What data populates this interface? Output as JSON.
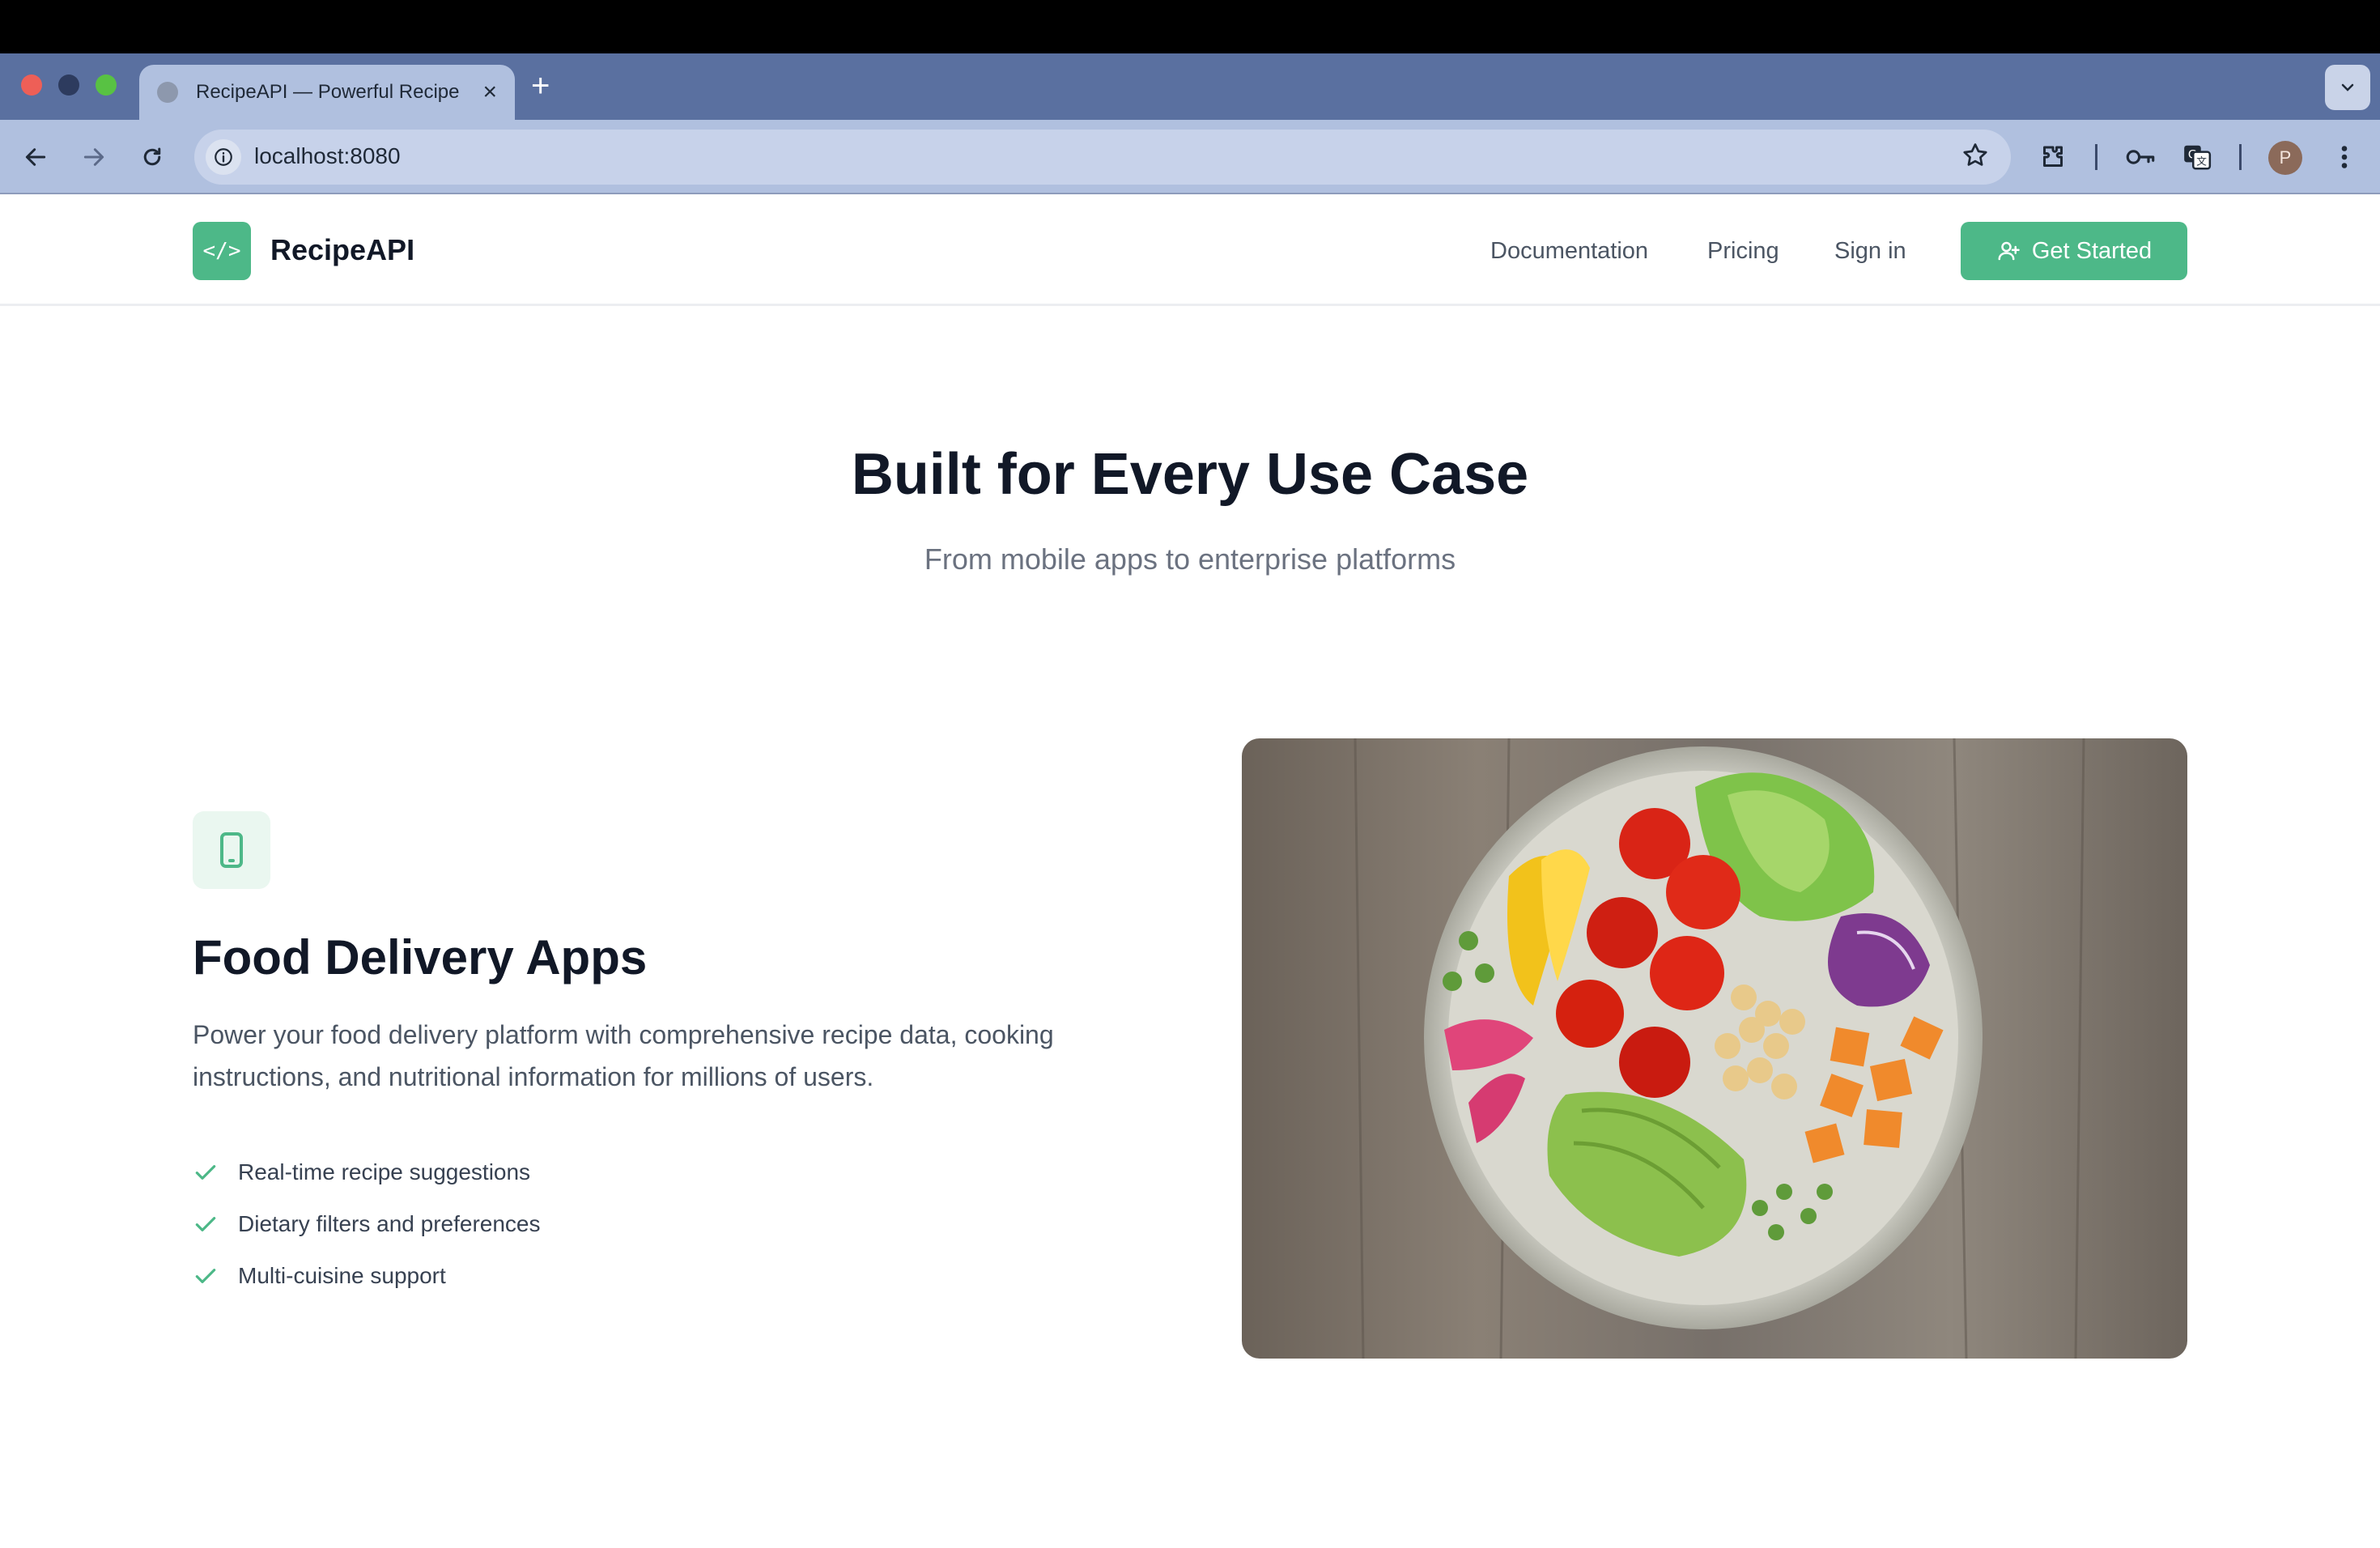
{
  "browser": {
    "tab_title": "RecipeAPI — Powerful Recipe",
    "tab_close": "×",
    "new_tab": "+",
    "url": "localhost:8080",
    "profile_initial": "P"
  },
  "header": {
    "logo_text": "</>",
    "brand": "RecipeAPI",
    "nav": [
      "Documentation",
      "Pricing",
      "Sign in"
    ],
    "cta_label": "Get Started"
  },
  "hero": {
    "title": "Built for Every Use Case",
    "subtitle": "From mobile apps to enterprise platforms"
  },
  "feature": {
    "icon": "smartphone-icon",
    "title": "Food Delivery Apps",
    "description": "Power your food delivery platform with comprehensive recipe data, cooking instructions, and nutritional information for millions of users.",
    "bullets": [
      "Real-time recipe suggestions",
      "Dietary filters and preferences",
      "Multi-cuisine support"
    ],
    "image": "salad-bowl-photo"
  },
  "colors": {
    "accent": "#4db888",
    "heading": "#111827",
    "body_text": "#4b5563"
  }
}
